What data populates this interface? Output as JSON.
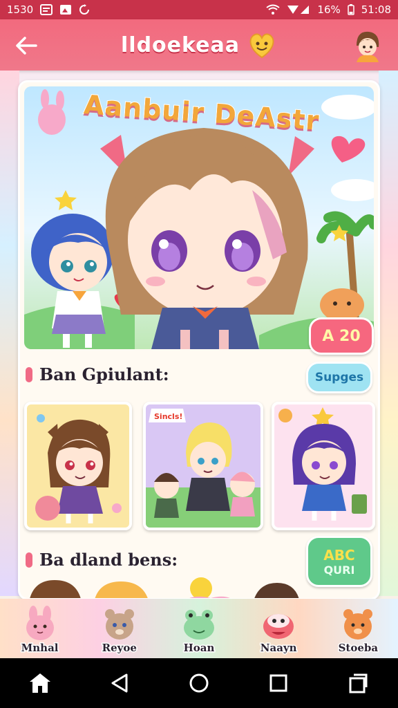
{
  "status_bar": {
    "time": "1530",
    "battery": "16%",
    "clock_right": "51:08"
  },
  "app_bar": {
    "title": "lldoekeaa",
    "back_icon": "arrow-left-icon",
    "emoji_icon": "smile-heart-icon",
    "avatar_icon": "profile-avatar-icon"
  },
  "hero": {
    "title": "Aanbuir DeAstr",
    "price_badge": "A 20"
  },
  "section1": {
    "title": "Ban Gpiulant:",
    "action_label": "Supges"
  },
  "thumbnails": [
    {
      "name": "brown-hair-chibi"
    },
    {
      "name": "blonde-group-chibi",
      "sticker": "Sincls!"
    },
    {
      "name": "purple-hair-chibi"
    }
  ],
  "section2": {
    "title": "Ba dland bens:",
    "quiz_line1": "ABC",
    "quiz_line2": "QURI"
  },
  "bottom_nav": [
    {
      "label": "Mnhal",
      "icon": "pink-bunny-icon",
      "color": "#f7a9c0"
    },
    {
      "label": "Reyoe",
      "icon": "brown-bear-icon",
      "color": "#c7a489"
    },
    {
      "label": "Hoan",
      "icon": "green-frog-icon",
      "color": "#8fd7a0"
    },
    {
      "label": "Naayn",
      "icon": "red-crab-icon",
      "color": "#f06672"
    },
    {
      "label": "Stoeba",
      "icon": "orange-bear-icon",
      "color": "#f0904a"
    }
  ],
  "colors": {
    "status_bar": "#c8324a",
    "app_bar": "#f26a7e",
    "accent_pink": "#f06a85",
    "accent_teal": "#9fe3f2",
    "accent_green": "#5fc98a"
  }
}
